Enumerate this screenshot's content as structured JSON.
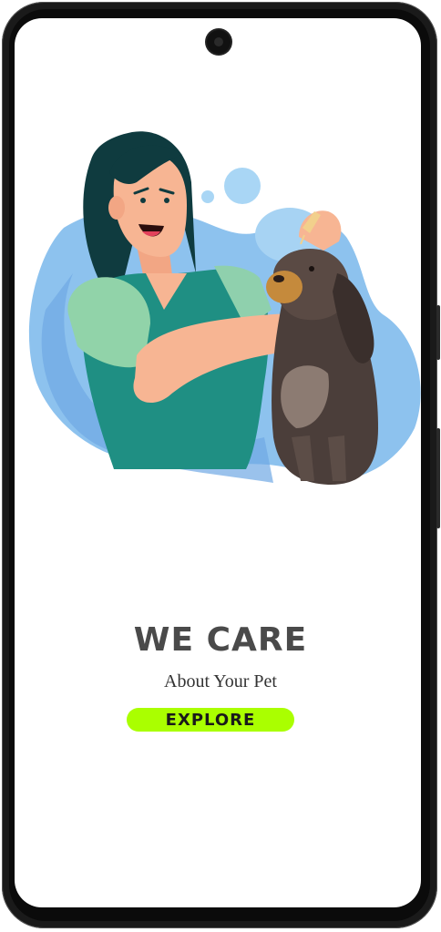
{
  "landing": {
    "headline": "WE CARE",
    "subtitle": "About Your Pet",
    "cta_label": "EXPLORE"
  },
  "colors": {
    "cta_background": "#aaff00",
    "headline_text": "#4a4a4a",
    "blob_blue": "#7fb8ea"
  },
  "illustration": {
    "icon": "woman-grooming-dog-illustration"
  }
}
